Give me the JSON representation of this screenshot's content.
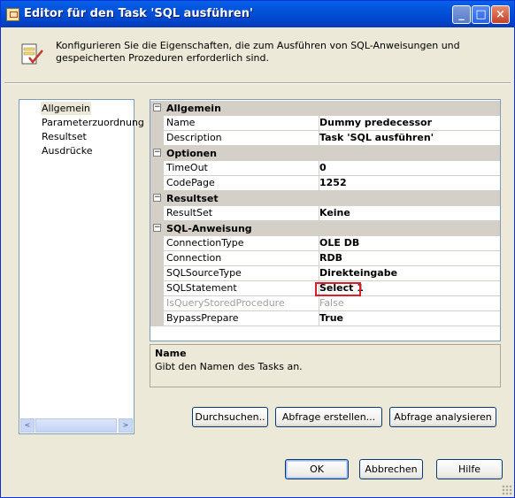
{
  "window": {
    "title": "Editor für den Task 'SQL ausführen'",
    "buttons": {
      "minimize": "_",
      "maximize": "□",
      "close": "×"
    }
  },
  "header": {
    "text": "Konfigurieren Sie die Eigenschaften, die zum Ausführen von SQL-Anweisungen und gespeicherten Prozeduren erforderlich sind.",
    "icon": "sql-task-icon"
  },
  "nav": {
    "items": [
      {
        "label": "Allgemein",
        "selected": true
      },
      {
        "label": "Parameterzuordnung"
      },
      {
        "label": "Resultset"
      },
      {
        "label": "Ausdrücke"
      }
    ],
    "scroll_left": "<",
    "scroll_right": ">"
  },
  "grid": {
    "categories": [
      {
        "label": "Allgemein",
        "toggle": "−",
        "rows": [
          {
            "name": "Name",
            "value": "Dummy predecessor"
          },
          {
            "name": "Description",
            "value": "Task 'SQL ausführen'"
          }
        ]
      },
      {
        "label": "Optionen",
        "toggle": "−",
        "rows": [
          {
            "name": "TimeOut",
            "value": "0"
          },
          {
            "name": "CodePage",
            "value": "1252"
          }
        ]
      },
      {
        "label": "Resultset",
        "toggle": "−",
        "rows": [
          {
            "name": "ResultSet",
            "value": "Keine"
          }
        ]
      },
      {
        "label": "SQL-Anweisung",
        "toggle": "−",
        "rows": [
          {
            "name": "ConnectionType",
            "value": "OLE DB"
          },
          {
            "name": "Connection",
            "value": "RDB"
          },
          {
            "name": "SQLSourceType",
            "value": "Direkteingabe"
          },
          {
            "name": "SQLStatement",
            "value": "Select 1",
            "highlighted": true
          },
          {
            "name": "IsQueryStoredProcedure",
            "value": "False",
            "disabled": true
          },
          {
            "name": "BypassPrepare",
            "value": "True"
          }
        ]
      }
    ]
  },
  "description": {
    "title": "Name",
    "text": "Gibt den Namen des Tasks an."
  },
  "actions": {
    "browse": "Durchsuchen..",
    "build_query": "Abfrage erstellen...",
    "parse_query": "Abfrage analysieren"
  },
  "footer": {
    "ok": "OK",
    "cancel": "Abbrechen",
    "help": "Hilfe"
  },
  "colors": {
    "titlebar": "#0054E3",
    "highlight_border": "#D8212A",
    "category_bg": "#D4D0C8"
  }
}
